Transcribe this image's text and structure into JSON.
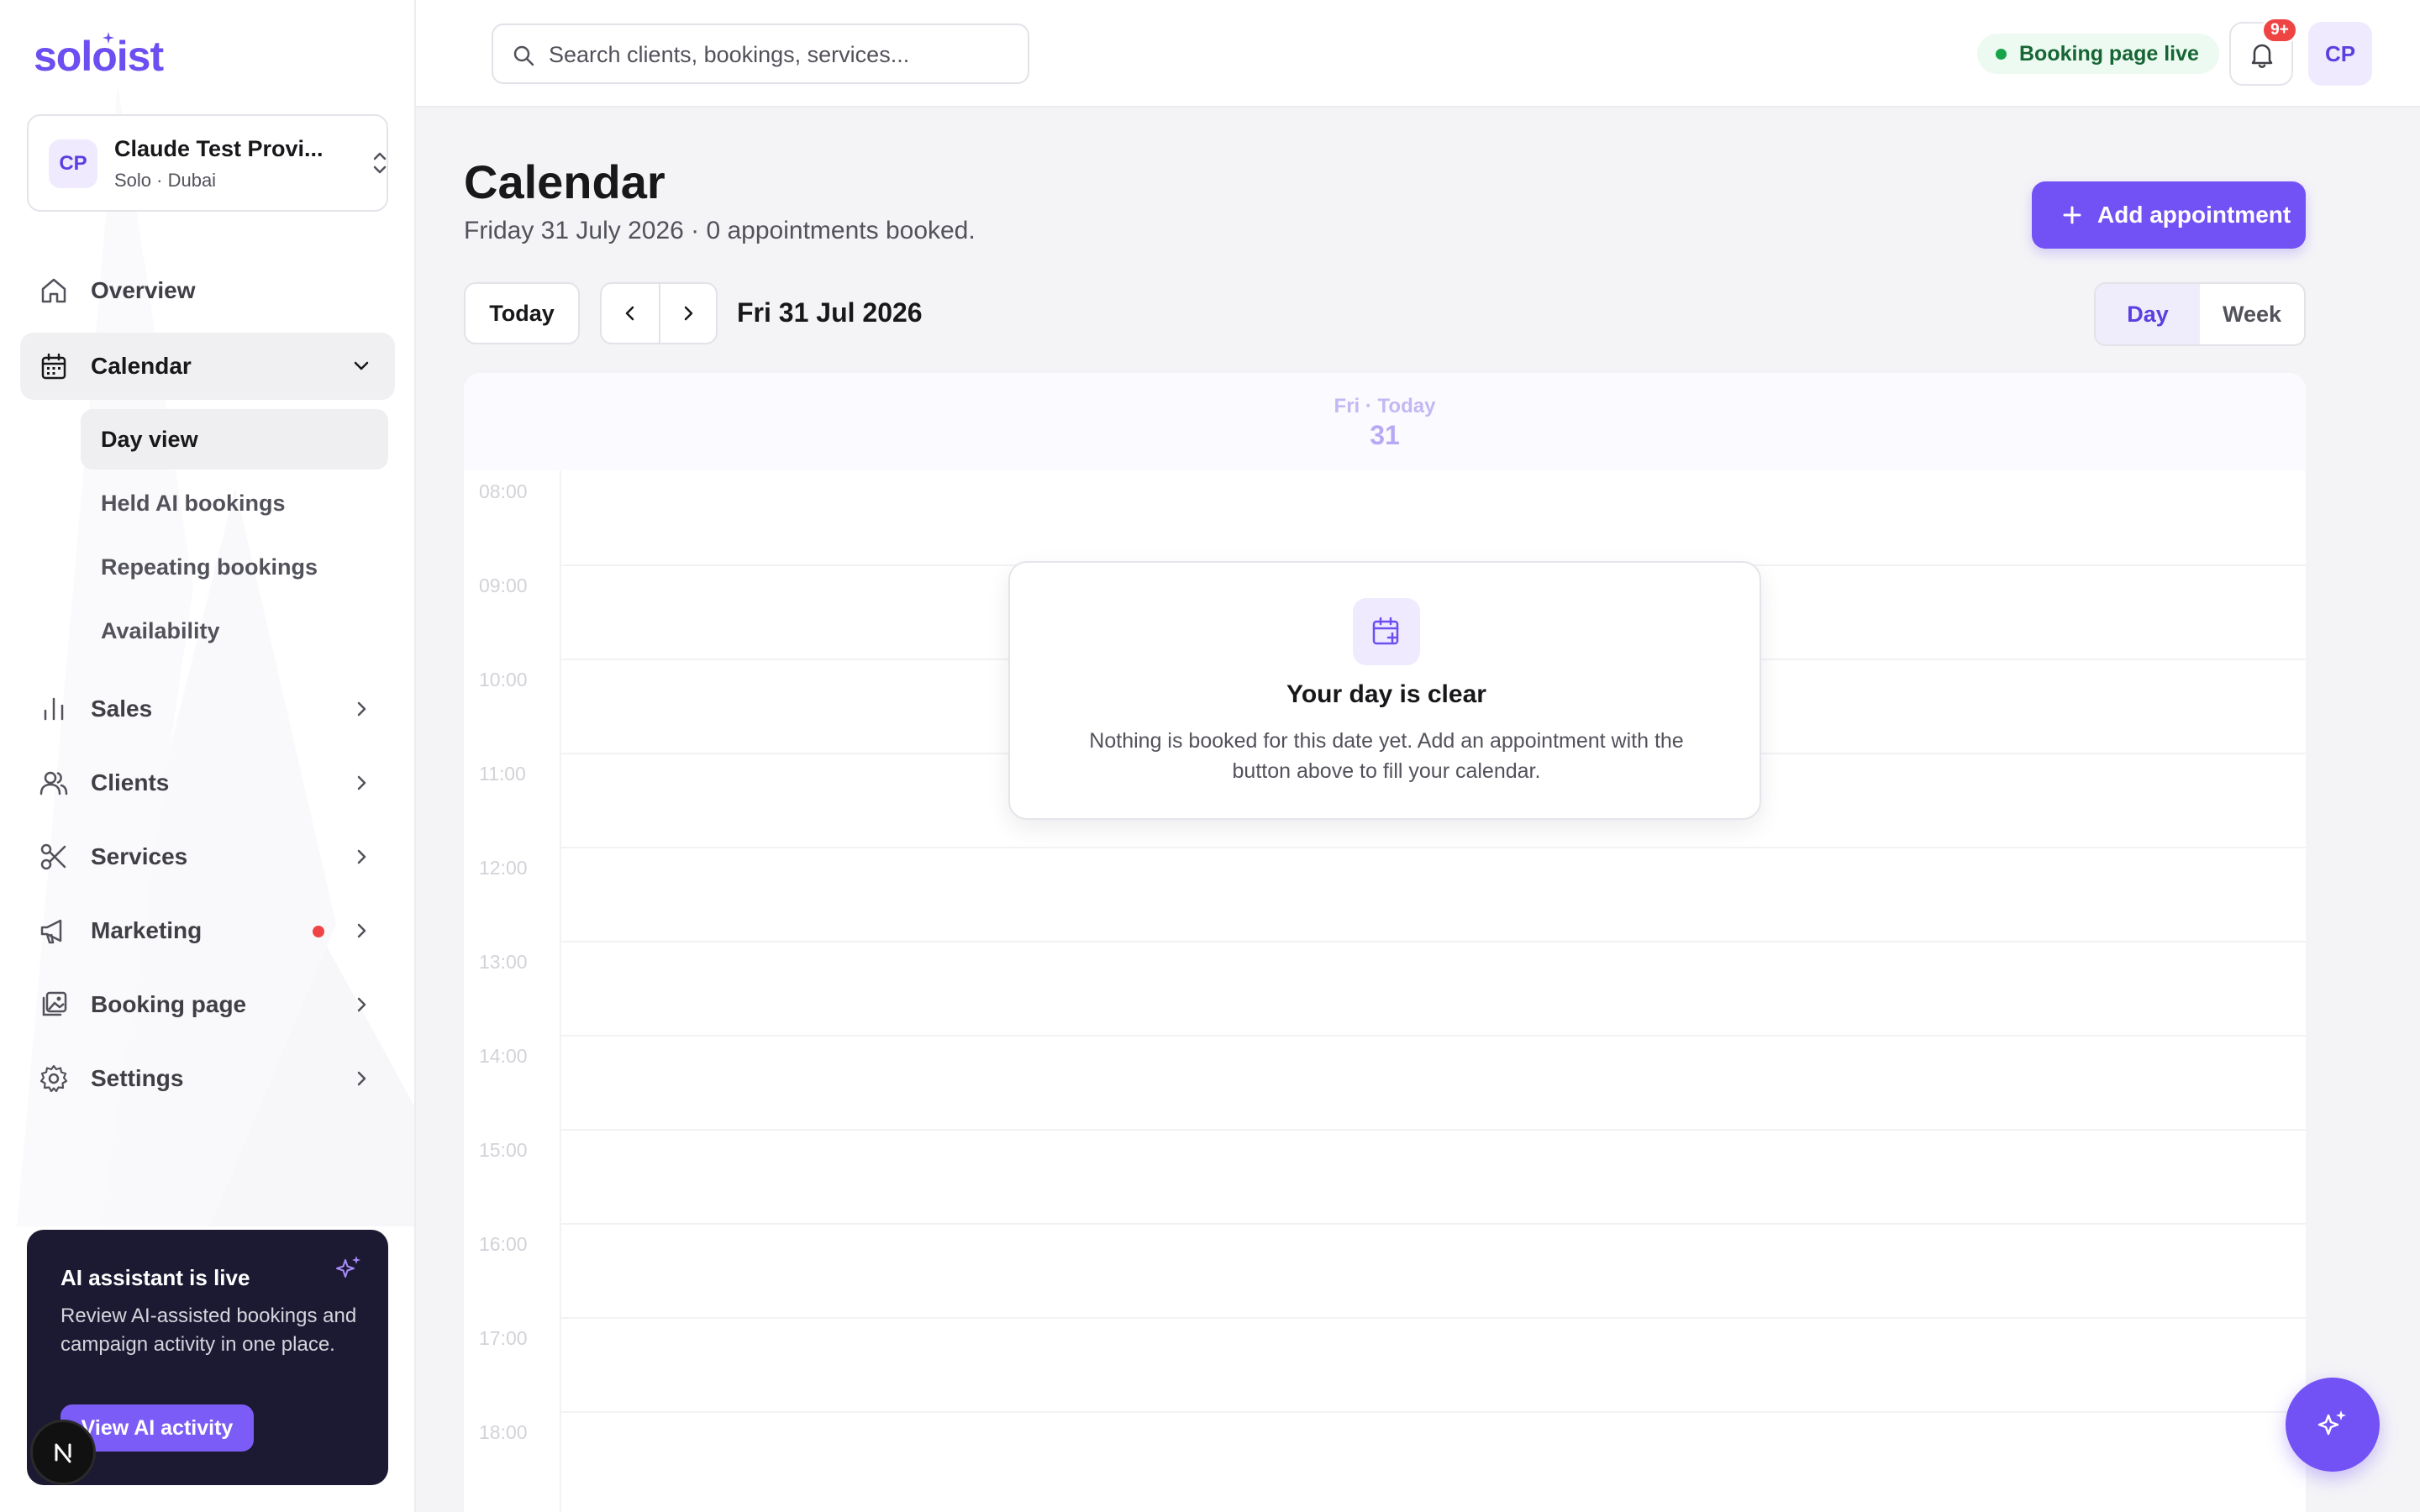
{
  "app": {
    "logo": "soloist"
  },
  "account": {
    "initials": "CP",
    "name": "Claude Test Provi...",
    "subtitle": "Solo · Dubai"
  },
  "nav": {
    "overview": "Overview",
    "calendar": "Calendar",
    "calendar_sub": [
      "Day view",
      "Held AI bookings",
      "Repeating bookings",
      "Availability"
    ],
    "sales": "Sales",
    "clients": "Clients",
    "services": "Services",
    "marketing": "Marketing",
    "booking_page": "Booking page",
    "settings": "Settings"
  },
  "ai_card": {
    "title": "AI assistant is live",
    "description": "Review AI-assisted bookings and campaign activity in one place.",
    "button": "View AI activity"
  },
  "topbar": {
    "search_placeholder": "Search clients, bookings, services...",
    "status": "Booking page live",
    "notifications_badge": "9+",
    "user_initials": "CP"
  },
  "page": {
    "title": "Calendar",
    "subtitle": "Friday 31 July 2026 · 0 appointments booked.",
    "add_button": "Add appointment",
    "today_button": "Today",
    "current_date": "Fri 31 Jul 2026",
    "views": [
      "Day",
      "Week"
    ],
    "active_view": "Day"
  },
  "calendar": {
    "day_label": "Fri · Today",
    "day_number": "31",
    "hours": [
      "08:00",
      "09:00",
      "10:00",
      "11:00",
      "12:00",
      "13:00",
      "14:00",
      "15:00",
      "16:00",
      "17:00",
      "18:00"
    ],
    "appointments": []
  },
  "empty_state": {
    "title": "Your day is clear",
    "description": "Nothing is booked for this date yet. Add an appointment with the button above to fill your calendar."
  },
  "colors": {
    "accent": "#7251f5",
    "accent_soft": "#efeafe",
    "live_green": "#16a34a",
    "alert_red": "#ef4444",
    "ai_card_bg": "#1c1a33"
  }
}
